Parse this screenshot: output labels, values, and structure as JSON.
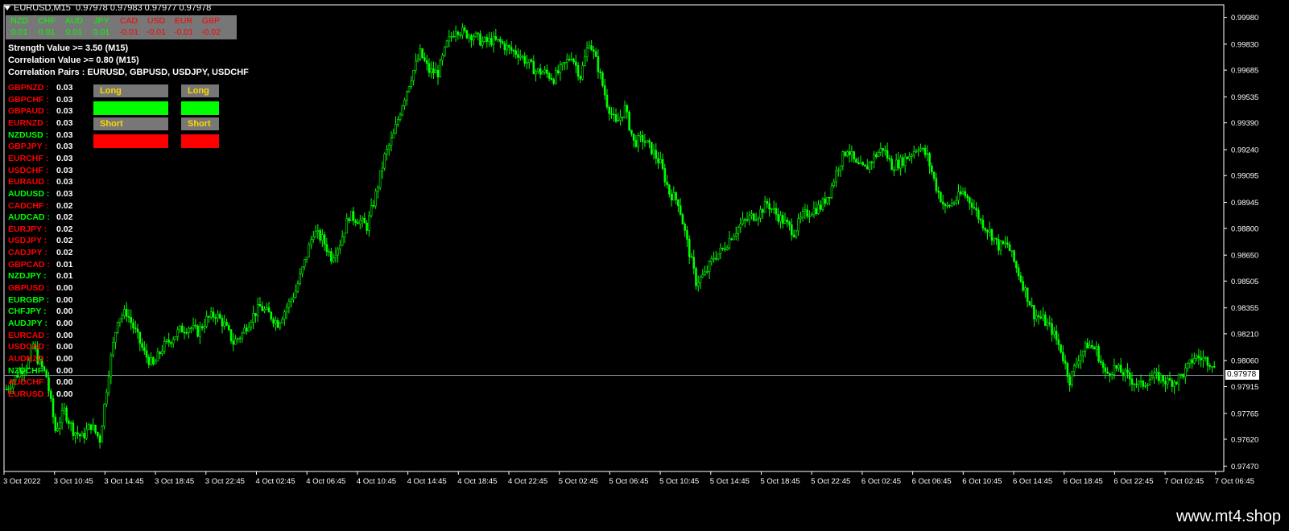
{
  "window": {
    "title": "EURUSD,M15",
    "quote": "0.97978 0.97983 0.97977 0.97978"
  },
  "currencies": [
    {
      "name": "NZD",
      "value": "0.01",
      "color": "#00ff00"
    },
    {
      "name": "CHF",
      "value": "0.01",
      "color": "#00ff00"
    },
    {
      "name": "AUD",
      "value": "0.01",
      "color": "#00ff00"
    },
    {
      "name": "JPY",
      "value": "0.01",
      "color": "#00ff00"
    },
    {
      "name": "CAD",
      "value": "-0.01",
      "color": "#ff0000"
    },
    {
      "name": "USD",
      "value": "-0.01",
      "color": "#ff0000"
    },
    {
      "name": "EUR",
      "value": "-0.01",
      "color": "#ff0000"
    },
    {
      "name": "GBP",
      "value": "-0.02",
      "color": "#ff0000"
    }
  ],
  "info": {
    "strength": "Strength Value >= 3.50    (M15)",
    "correlation": "Correlation Value >= 0.80    (M15)",
    "pairs": "Correlation Pairs : EURUSD, GBPUSD, USDJPY, USDCHF"
  },
  "pairs": [
    {
      "name": "GBPNZD :",
      "value": "0.03",
      "color": "#ff0000"
    },
    {
      "name": "GBPCHF :",
      "value": "0.03",
      "color": "#ff0000"
    },
    {
      "name": "GBPAUD :",
      "value": "0.03",
      "color": "#ff0000"
    },
    {
      "name": "EURNZD :",
      "value": "0.03",
      "color": "#ff0000"
    },
    {
      "name": "NZDUSD :",
      "value": "0.03",
      "color": "#00ff00"
    },
    {
      "name": "GBPJPY :",
      "value": "0.03",
      "color": "#ff0000"
    },
    {
      "name": "EURCHF :",
      "value": "0.03",
      "color": "#ff0000"
    },
    {
      "name": "USDCHF :",
      "value": "0.03",
      "color": "#ff0000"
    },
    {
      "name": "EURAUD :",
      "value": "0.03",
      "color": "#ff0000"
    },
    {
      "name": "AUDUSD :",
      "value": "0.03",
      "color": "#00ff00"
    },
    {
      "name": "CADCHF :",
      "value": "0.02",
      "color": "#ff0000"
    },
    {
      "name": "AUDCAD :",
      "value": "0.02",
      "color": "#00ff00"
    },
    {
      "name": "EURJPY :",
      "value": "0.02",
      "color": "#ff0000"
    },
    {
      "name": "USDJPY :",
      "value": "0.02",
      "color": "#ff0000"
    },
    {
      "name": "CADJPY :",
      "value": "0.02",
      "color": "#ff0000"
    },
    {
      "name": "GBPCAD :",
      "value": "0.01",
      "color": "#ff0000"
    },
    {
      "name": "NZDJPY :",
      "value": "0.01",
      "color": "#00ff00"
    },
    {
      "name": "GBPUSD :",
      "value": "0.00",
      "color": "#ff0000"
    },
    {
      "name": "EURGBP :",
      "value": "0.00",
      "color": "#00ff00"
    },
    {
      "name": "CHFJPY :",
      "value": "0.00",
      "color": "#00ff00"
    },
    {
      "name": "AUDJPY :",
      "value": "0.00",
      "color": "#00ff00"
    },
    {
      "name": "EURCAD :",
      "value": "0.00",
      "color": "#ff0000"
    },
    {
      "name": "USDCAD :",
      "value": "0.00",
      "color": "#ff0000"
    },
    {
      "name": "AUDNZD :",
      "value": "0.00",
      "color": "#ff0000"
    },
    {
      "name": "NZDCHF :",
      "value": "0.00",
      "color": "#00ff00"
    },
    {
      "name": "AUDCHF :",
      "value": "0.00",
      "color": "#ff0000"
    },
    {
      "name": "EURUSD :",
      "value": "0.00",
      "color": "#ff0000"
    }
  ],
  "buttons": {
    "long1": "Long",
    "long2": "Long",
    "short1": "Short",
    "short2": "Short",
    "long_color": "#00ff00",
    "short_color": "#ff0000"
  },
  "current_price": "0.97978",
  "footer": {
    "site": "www.mt4.shop"
  },
  "chart_data": {
    "type": "candlestick",
    "symbol": "EURUSD",
    "timeframe": "M15",
    "y_ticks": [
      "0.99980",
      "0.99830",
      "0.99685",
      "0.99535",
      "0.99390",
      "0.99240",
      "0.99095",
      "0.98945",
      "0.98800",
      "0.98650",
      "0.98505",
      "0.98355",
      "0.98210",
      "0.98060",
      "0.97915",
      "0.97765",
      "0.97620",
      "0.97470"
    ],
    "x_ticks": [
      "3 Oct 2022",
      "3 Oct 10:45",
      "3 Oct 14:45",
      "3 Oct 18:45",
      "3 Oct 22:45",
      "4 Oct 02:45",
      "4 Oct 06:45",
      "4 Oct 10:45",
      "4 Oct 14:45",
      "4 Oct 18:45",
      "4 Oct 22:45",
      "5 Oct 02:45",
      "5 Oct 06:45",
      "5 Oct 10:45",
      "5 Oct 14:45",
      "5 Oct 18:45",
      "5 Oct 22:45",
      "6 Oct 02:45",
      "6 Oct 06:45",
      "6 Oct 10:45",
      "6 Oct 14:45",
      "6 Oct 18:45",
      "6 Oct 22:45",
      "7 Oct 02:45",
      "7 Oct 06:45"
    ],
    "ylim": [
      0.9744,
      1.0005
    ],
    "current_price": 0.97978,
    "price_path": [
      [
        0,
        0.979
      ],
      [
        3,
        0.98
      ],
      [
        5,
        0.9805
      ],
      [
        6,
        0.9815
      ],
      [
        7,
        0.9807
      ],
      [
        9,
        0.9797
      ],
      [
        11,
        0.9767
      ],
      [
        13,
        0.9778
      ],
      [
        15,
        0.9767
      ],
      [
        17,
        0.9763
      ],
      [
        19,
        0.977
      ],
      [
        21,
        0.9762
      ],
      [
        23,
        0.98
      ],
      [
        25,
        0.983
      ],
      [
        27,
        0.9833
      ],
      [
        29,
        0.9822
      ],
      [
        31,
        0.981
      ],
      [
        33,
        0.9803
      ],
      [
        35,
        0.9813
      ],
      [
        37,
        0.9818
      ],
      [
        39,
        0.9823
      ],
      [
        41,
        0.9825
      ],
      [
        43,
        0.9822
      ],
      [
        45,
        0.9829
      ],
      [
        47,
        0.9832
      ],
      [
        49,
        0.9826
      ],
      [
        51,
        0.9816
      ],
      [
        53,
        0.9821
      ],
      [
        55,
        0.983
      ],
      [
        57,
        0.9836
      ],
      [
        59,
        0.9832
      ],
      [
        61,
        0.9827
      ],
      [
        63,
        0.9836
      ],
      [
        65,
        0.9845
      ],
      [
        67,
        0.9861
      ],
      [
        69,
        0.9878
      ],
      [
        71,
        0.9874
      ],
      [
        73,
        0.9864
      ],
      [
        75,
        0.9872
      ],
      [
        77,
        0.9887
      ],
      [
        79,
        0.9885
      ],
      [
        81,
        0.9881
      ],
      [
        83,
        0.9899
      ],
      [
        85,
        0.992
      ],
      [
        87,
        0.9932
      ],
      [
        89,
        0.995
      ],
      [
        91,
        0.9965
      ],
      [
        93,
        0.9978
      ],
      [
        95,
        0.9968
      ],
      [
        97,
        0.9967
      ],
      [
        99,
        0.9983
      ],
      [
        101,
        0.9992
      ],
      [
        103,
        0.9989
      ],
      [
        105,
        0.9988
      ],
      [
        107,
        0.9984
      ],
      [
        109,
        0.9985
      ],
      [
        111,
        0.9984
      ],
      [
        113,
        0.998
      ],
      [
        115,
        0.9978
      ],
      [
        117,
        0.9973
      ],
      [
        119,
        0.9968
      ],
      [
        121,
        0.9967
      ],
      [
        123,
        0.9964
      ],
      [
        125,
        0.997
      ],
      [
        127,
        0.9977
      ],
      [
        129,
        0.9965
      ],
      [
        131,
        0.9985
      ],
      [
        133,
        0.997
      ],
      [
        135,
        0.995
      ],
      [
        137,
        0.9938
      ],
      [
        139,
        0.9947
      ],
      [
        141,
        0.9928
      ],
      [
        143,
        0.993
      ],
      [
        145,
        0.9924
      ],
      [
        147,
        0.9916
      ],
      [
        149,
        0.99
      ],
      [
        151,
        0.9895
      ],
      [
        153,
        0.9872
      ],
      [
        155,
        0.985
      ],
      [
        157,
        0.9854
      ],
      [
        159,
        0.9864
      ],
      [
        161,
        0.9868
      ],
      [
        163,
        0.9876
      ],
      [
        165,
        0.9882
      ],
      [
        167,
        0.9886
      ],
      [
        169,
        0.9888
      ],
      [
        171,
        0.9894
      ],
      [
        173,
        0.9888
      ],
      [
        175,
        0.9883
      ],
      [
        177,
        0.9878
      ],
      [
        179,
        0.9887
      ],
      [
        181,
        0.989
      ],
      [
        183,
        0.9892
      ],
      [
        185,
        0.99
      ],
      [
        187,
        0.9915
      ],
      [
        189,
        0.9925
      ],
      [
        191,
        0.9915
      ],
      [
        193,
        0.9913
      ],
      [
        195,
        0.992
      ],
      [
        197,
        0.9925
      ],
      [
        199,
        0.9915
      ],
      [
        201,
        0.9917
      ],
      [
        203,
        0.9921
      ],
      [
        205,
        0.9926
      ],
      [
        207,
        0.992
      ],
      [
        209,
        0.9903
      ],
      [
        211,
        0.9891
      ],
      [
        213,
        0.9895
      ],
      [
        215,
        0.99
      ],
      [
        217,
        0.9894
      ],
      [
        219,
        0.9884
      ],
      [
        221,
        0.9878
      ],
      [
        223,
        0.987
      ],
      [
        225,
        0.9871
      ],
      [
        227,
        0.9858
      ],
      [
        229,
        0.9845
      ],
      [
        231,
        0.9832
      ],
      [
        233,
        0.9829
      ],
      [
        235,
        0.9823
      ],
      [
        237,
        0.9812
      ],
      [
        239,
        0.9795
      ],
      [
        241,
        0.9808
      ],
      [
        243,
        0.9815
      ],
      [
        245,
        0.9812
      ],
      [
        247,
        0.9798
      ],
      [
        249,
        0.9802
      ],
      [
        251,
        0.9799
      ],
      [
        253,
        0.9795
      ],
      [
        255,
        0.9792
      ],
      [
        257,
        0.9796
      ],
      [
        259,
        0.9797
      ],
      [
        261,
        0.9794
      ],
      [
        263,
        0.9795
      ],
      [
        265,
        0.98
      ],
      [
        267,
        0.9808
      ],
      [
        269,
        0.9807
      ],
      [
        271,
        0.9805
      ],
      [
        272,
        0.9798
      ]
    ]
  }
}
